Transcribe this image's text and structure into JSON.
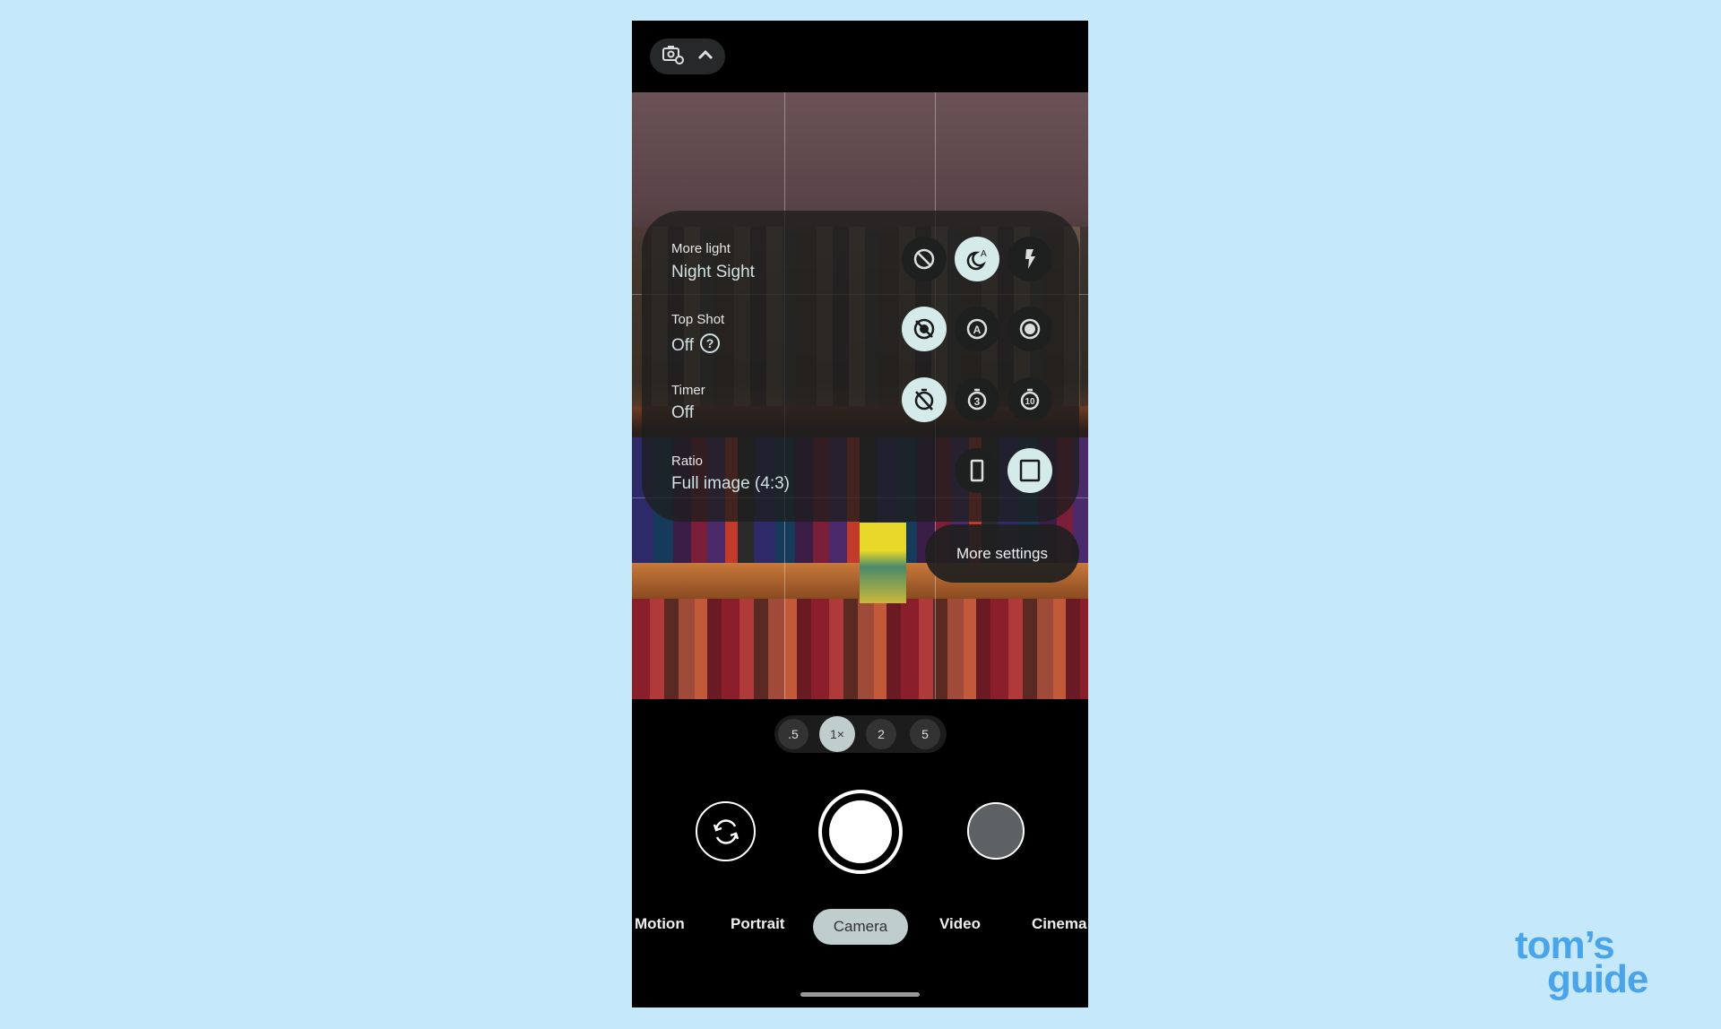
{
  "top_bar": {
    "icons": [
      "camera-settings-icon",
      "chevron-up-icon"
    ]
  },
  "settings_panel": {
    "rows": [
      {
        "label": "More light",
        "value": "Night Sight",
        "options": [
          "flash-off-icon",
          "night-sight-auto-icon",
          "flash-on-icon"
        ],
        "selected": 1
      },
      {
        "label": "Top Shot",
        "value": "Off",
        "has_help": true,
        "options": [
          "top-shot-off-icon",
          "top-shot-auto-icon",
          "top-shot-on-icon"
        ],
        "selected": 0
      },
      {
        "label": "Timer",
        "value": "Off",
        "options": [
          "timer-off-icon",
          "timer-3s-icon",
          "timer-10s-icon"
        ],
        "selected": 0
      },
      {
        "label": "Ratio",
        "value": "Full image (4:3)",
        "options": [
          "ratio-wide-icon",
          "ratio-full-icon"
        ],
        "selected": 1
      }
    ],
    "more_settings_label": "More settings"
  },
  "zoom": {
    "levels": [
      ".5",
      "1×",
      "2",
      "5"
    ],
    "selected": 1
  },
  "modes": {
    "items": [
      "Motion",
      "Portrait",
      "Camera",
      "Video",
      "Cinema"
    ],
    "selected": "Camera"
  },
  "watermark": {
    "line1": "tom’s",
    "line2": "guide"
  },
  "colors": {
    "background": "#c6e8fb",
    "selected_option": "#d4ebea",
    "selected_mode": "#bfcdcd",
    "watermark": "#4aa4ea"
  }
}
